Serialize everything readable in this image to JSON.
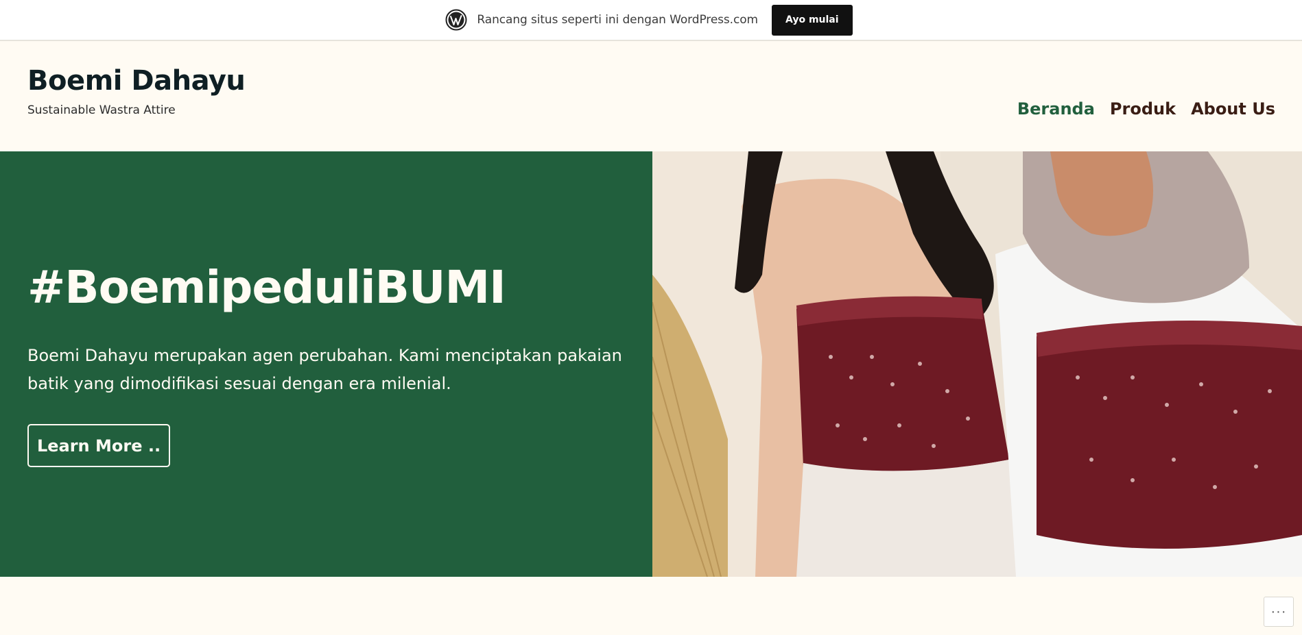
{
  "promo_bar": {
    "text": "Rancang situs seperti ini dengan WordPress.com",
    "button_label": "Ayo mulai",
    "logo_icon": "wordpress-logo-icon"
  },
  "header": {
    "site_title": "Boemi Dahayu",
    "tagline": "Sustainable Wastra Attire",
    "nav": [
      {
        "label": "Beranda",
        "active": true
      },
      {
        "label": "Produk",
        "active": false
      },
      {
        "label": "About Us",
        "active": false
      }
    ]
  },
  "hero": {
    "title": "#BoemipeduliBUMI",
    "text": "Boemi Dahayu merupakan agen perubahan. Kami menciptakan pakaian batik yang dimodifikasi sesuai dengan era milenial.",
    "button_label": "Learn More ..",
    "image_icon": "hero-photo-two-models-batik-tops"
  },
  "floating": {
    "more_icon": "ellipsis-icon",
    "more_glyph": "···"
  },
  "colors": {
    "background": "#fffbf3",
    "hero_green": "#215f3d",
    "nav_active": "#215f3d",
    "nav_text": "#3a1d14",
    "title_text": "#0f1f24",
    "promo_button": "#111111"
  }
}
